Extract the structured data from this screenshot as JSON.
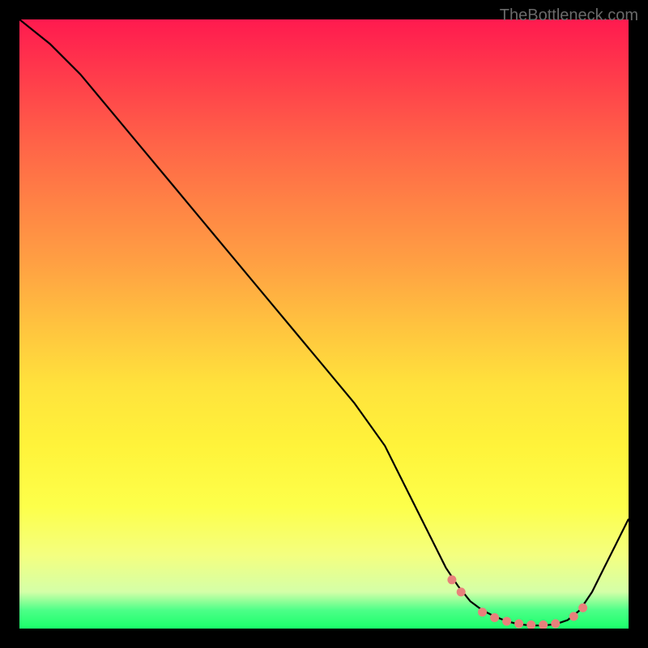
{
  "watermark": "TheBottleneck.com",
  "chart_data": {
    "type": "line",
    "title": "",
    "xlabel": "",
    "ylabel": "",
    "xlim": [
      0,
      100
    ],
    "ylim": [
      0,
      100
    ],
    "series": [
      {
        "name": "bottleneck-curve",
        "x": [
          0,
          5,
          10,
          15,
          20,
          25,
          30,
          35,
          40,
          45,
          50,
          55,
          60,
          62,
          64,
          66,
          68,
          70,
          72,
          74,
          76,
          78,
          80,
          82,
          84,
          86,
          88,
          90,
          92,
          94,
          96,
          98,
          100
        ],
        "y": [
          100,
          96,
          91,
          85,
          79,
          73,
          67,
          61,
          55,
          49,
          43,
          37,
          30,
          26,
          22,
          18,
          14,
          10,
          7,
          4.5,
          3,
          2,
          1.2,
          0.7,
          0.5,
          0.5,
          0.7,
          1.4,
          3,
          6,
          10,
          14,
          18
        ]
      }
    ],
    "markers": {
      "name": "optimal-range-dots",
      "x": [
        71,
        72.5,
        76,
        78,
        80,
        82,
        84,
        86,
        88,
        91,
        92.5
      ],
      "y": [
        8,
        6,
        2.7,
        1.8,
        1.2,
        0.8,
        0.6,
        0.6,
        0.8,
        2.0,
        3.4
      ]
    },
    "colors": {
      "curve": "#000000",
      "markers": "#e8817b",
      "gradient_top": "#ff1a4f",
      "gradient_bottom": "#1aff6a"
    }
  }
}
